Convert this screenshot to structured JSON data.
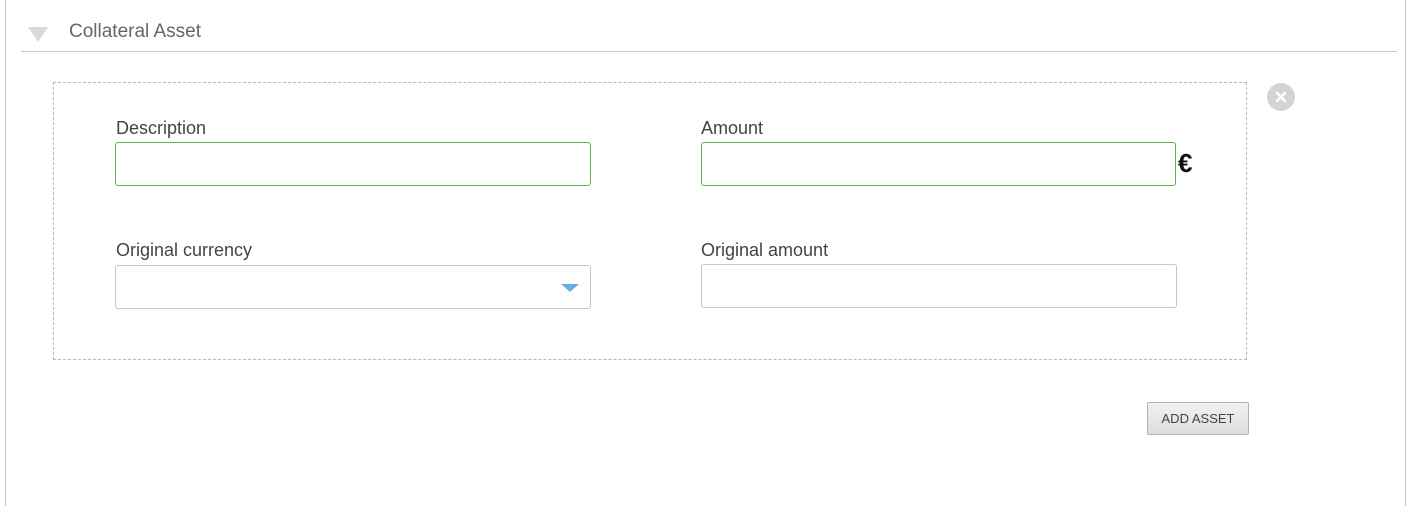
{
  "section": {
    "title": "Collateral Asset",
    "collapse_icon": "triangle-down-icon"
  },
  "asset_form": {
    "remove_icon": "close-circle-icon",
    "description": {
      "label": "Description",
      "value": "",
      "placeholder": ""
    },
    "amount": {
      "label": "Amount",
      "value": "",
      "placeholder": "",
      "currency_symbol": "€"
    },
    "original_currency": {
      "label": "Original currency",
      "selected": ""
    },
    "original_amount": {
      "label": "Original amount",
      "value": "",
      "placeholder": ""
    }
  },
  "add_button_label": "ADD ASSET",
  "colors": {
    "valid_border": "#5db745",
    "dropdown_arrow": "#6aaedd",
    "panel_border": "#c8c8c8"
  }
}
